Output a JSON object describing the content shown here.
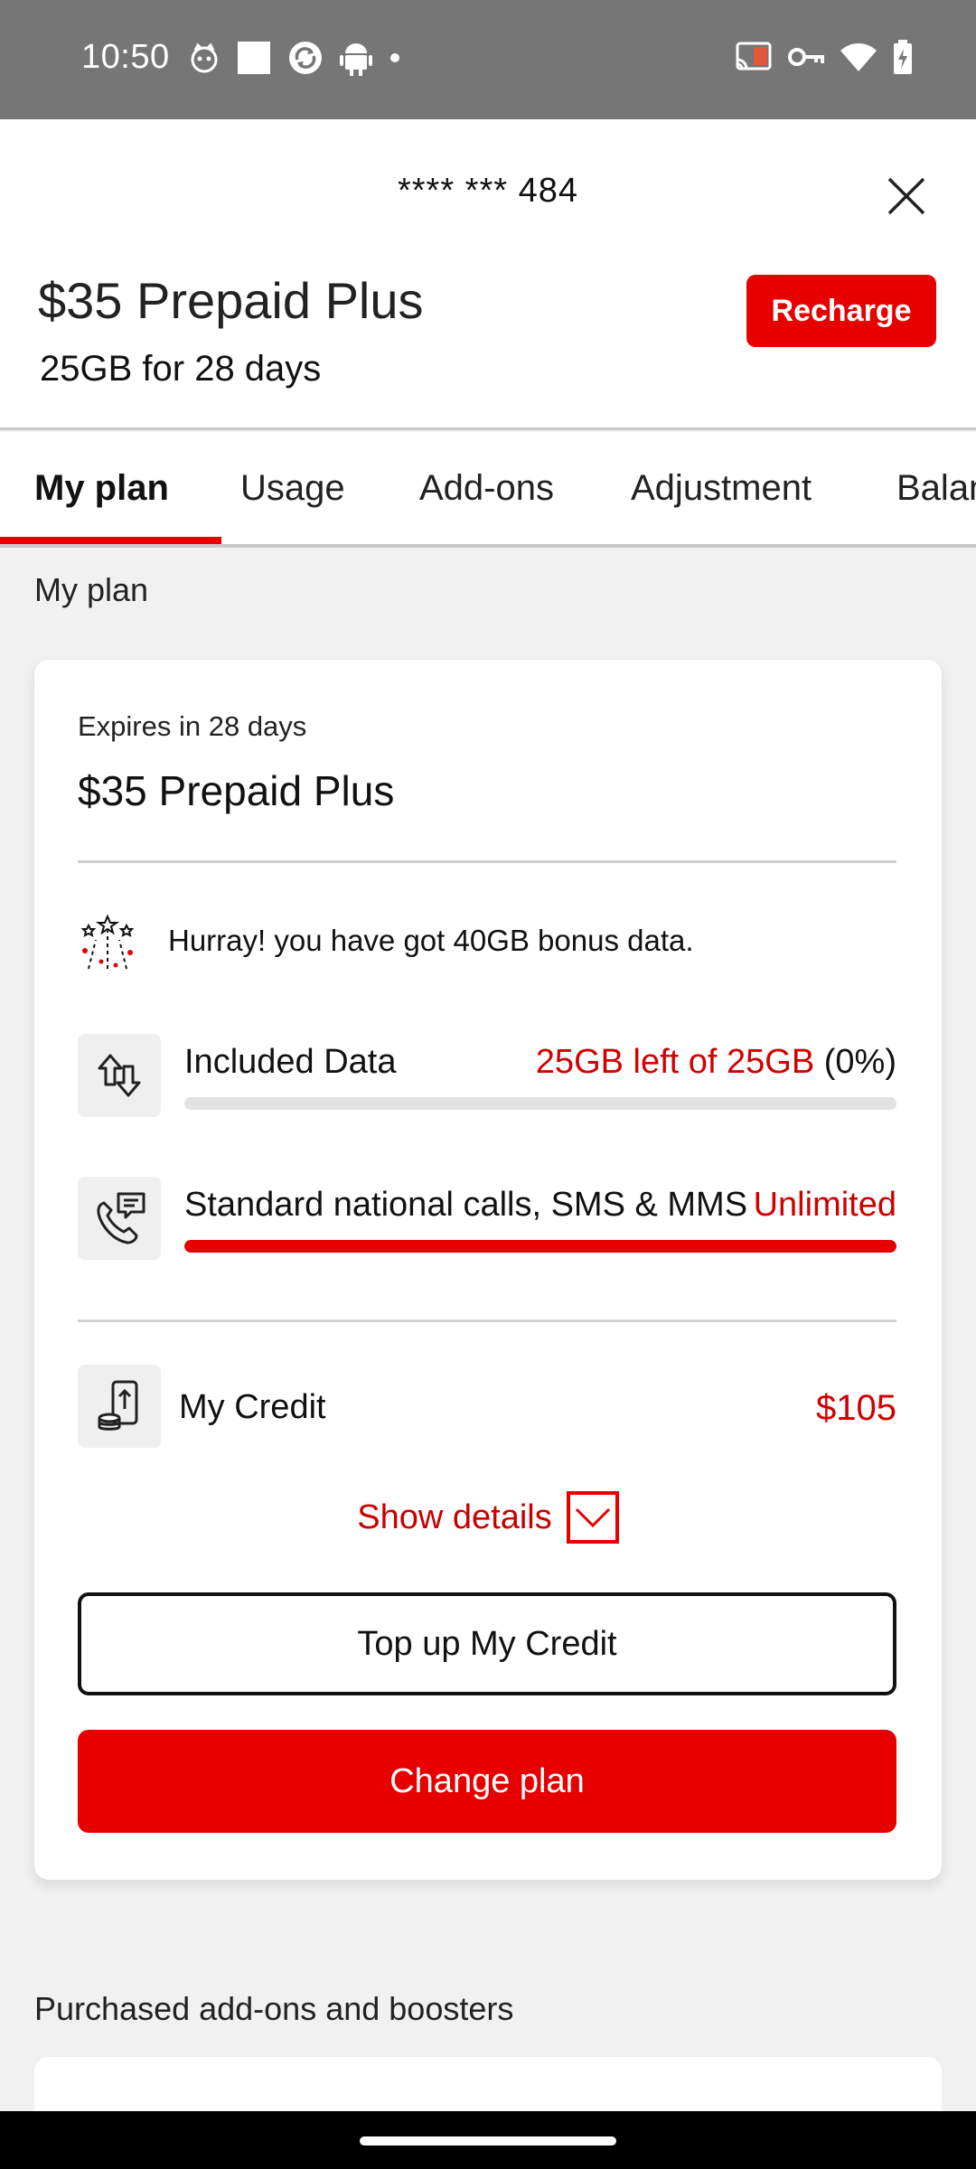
{
  "status_bar": {
    "time": "10:50",
    "left_icons": [
      "cat-icon",
      "square-icon",
      "sync-icon",
      "android-icon",
      "dot-icon"
    ],
    "right_icons": [
      "cast-icon",
      "vpn-key-icon",
      "wifi-icon",
      "battery-charging-icon"
    ]
  },
  "header": {
    "account_number": "**** *** 484",
    "plan_title": "$35 Prepaid Plus",
    "plan_sub": "25GB for 28 days",
    "recharge_label": "Recharge"
  },
  "tabs": [
    {
      "label": "My plan",
      "active": true
    },
    {
      "label": "Usage",
      "active": false
    },
    {
      "label": "Add-ons",
      "active": false
    },
    {
      "label": "Adjustment",
      "active": false
    },
    {
      "label": "Balan",
      "active": false
    }
  ],
  "section_title": "My plan",
  "card": {
    "expires": "Expires in 28 days",
    "plan_name": "$35 Prepaid Plus",
    "bonus_text": "Hurray! you have got 40GB bonus data.",
    "data_row": {
      "label": "Included Data",
      "value": "25GB left of 25GB",
      "percent_text": "(0%)",
      "used_fraction": 0
    },
    "calls_row": {
      "label": "Standard national calls, SMS & MMS",
      "value": "Unlimited",
      "used_fraction": 1
    },
    "credit_row": {
      "label": "My Credit",
      "value": "$105"
    },
    "show_details": "Show details",
    "topup_label": "Top up My Credit",
    "change_plan_label": "Change plan"
  },
  "addons_title": "Purchased add-ons and boosters",
  "colors": {
    "brand_red": "#e60000",
    "status_bar": "#767676",
    "page_bg": "#f1f1f1"
  }
}
